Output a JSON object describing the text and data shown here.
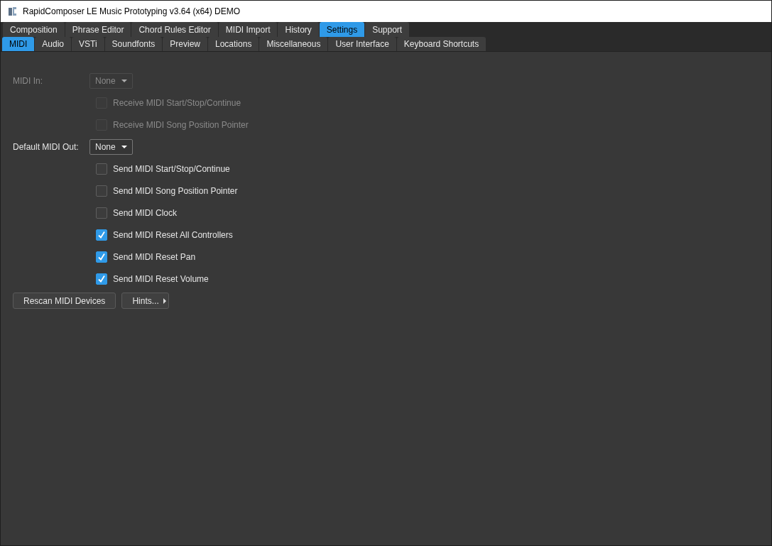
{
  "window": {
    "title": "RapidComposer LE Music Prototyping v3.64 (x64) DEMO"
  },
  "tabs": [
    {
      "label": "Composition",
      "selected": false
    },
    {
      "label": "Phrase Editor",
      "selected": false
    },
    {
      "label": "Chord Rules Editor",
      "selected": false
    },
    {
      "label": "MIDI Import",
      "selected": false
    },
    {
      "label": "History",
      "selected": false
    },
    {
      "label": "Settings",
      "selected": true
    },
    {
      "label": "Support",
      "selected": false
    }
  ],
  "subtabs": [
    {
      "label": "MIDI",
      "selected": true
    },
    {
      "label": "Audio",
      "selected": false
    },
    {
      "label": "VSTi",
      "selected": false
    },
    {
      "label": "Soundfonts",
      "selected": false
    },
    {
      "label": "Preview",
      "selected": false
    },
    {
      "label": "Locations",
      "selected": false
    },
    {
      "label": "Miscellaneous",
      "selected": false
    },
    {
      "label": "User Interface",
      "selected": false
    },
    {
      "label": "Keyboard Shortcuts",
      "selected": false
    }
  ],
  "rows": [
    {
      "kind": "dropdown",
      "label": "MIDI In:",
      "value": "None",
      "disabled": true
    },
    {
      "kind": "checkbox",
      "label": "Receive MIDI Start/Stop/Continue",
      "checked": false,
      "disabled": true
    },
    {
      "kind": "checkbox",
      "label": "Receive MIDI Song Position Pointer",
      "checked": false,
      "disabled": true
    },
    {
      "kind": "dropdown",
      "label": "Default MIDI Out:",
      "value": "None",
      "disabled": false
    },
    {
      "kind": "checkbox",
      "label": "Send MIDI Start/Stop/Continue",
      "checked": false,
      "disabled": false
    },
    {
      "kind": "checkbox",
      "label": "Send MIDI Song Position Pointer",
      "checked": false,
      "disabled": false
    },
    {
      "kind": "checkbox",
      "label": "Send MIDI Clock",
      "checked": false,
      "disabled": false
    },
    {
      "kind": "checkbox",
      "label": "Send MIDI Reset All Controllers",
      "checked": true,
      "disabled": false
    },
    {
      "kind": "checkbox",
      "label": "Send MIDI Reset Pan",
      "checked": true,
      "disabled": false
    },
    {
      "kind": "checkbox",
      "label": "Send MIDI Reset Volume",
      "checked": true,
      "disabled": false
    }
  ],
  "buttons": [
    {
      "label": "Rescan MIDI Devices",
      "kind": "plain"
    },
    {
      "label": "Hints...",
      "kind": "menu"
    }
  ]
}
